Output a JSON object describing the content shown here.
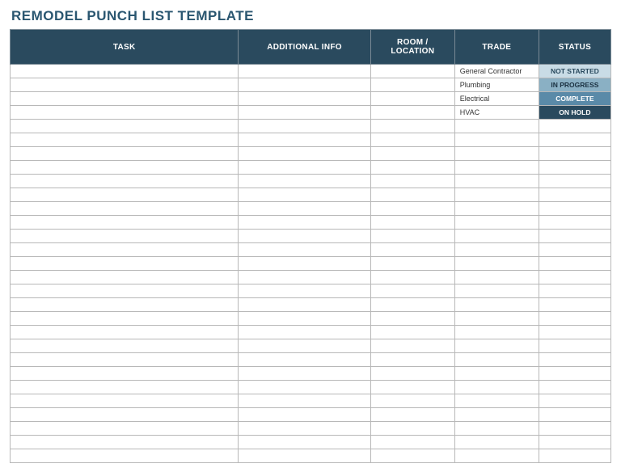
{
  "title": "REMODEL PUNCH LIST TEMPLATE",
  "columns": {
    "task": "TASK",
    "additional_info": "ADDITIONAL INFO",
    "room_location": "ROOM / LOCATION",
    "trade": "TRADE",
    "status": "STATUS"
  },
  "rows": [
    {
      "task": "",
      "info": "",
      "room": "",
      "trade": "General Contractor",
      "status": "NOT STARTED",
      "status_class": "status-not-started"
    },
    {
      "task": "",
      "info": "",
      "room": "",
      "trade": "Plumbing",
      "status": "IN PROGRESS",
      "status_class": "status-in-progress"
    },
    {
      "task": "",
      "info": "",
      "room": "",
      "trade": "Electrical",
      "status": "COMPLETE",
      "status_class": "status-complete"
    },
    {
      "task": "",
      "info": "",
      "room": "",
      "trade": "HVAC",
      "status": "ON HOLD",
      "status_class": "status-on-hold"
    },
    {
      "task": "",
      "info": "",
      "room": "",
      "trade": "",
      "status": "",
      "status_class": ""
    },
    {
      "task": "",
      "info": "",
      "room": "",
      "trade": "",
      "status": "",
      "status_class": ""
    },
    {
      "task": "",
      "info": "",
      "room": "",
      "trade": "",
      "status": "",
      "status_class": ""
    },
    {
      "task": "",
      "info": "",
      "room": "",
      "trade": "",
      "status": "",
      "status_class": ""
    },
    {
      "task": "",
      "info": "",
      "room": "",
      "trade": "",
      "status": "",
      "status_class": ""
    },
    {
      "task": "",
      "info": "",
      "room": "",
      "trade": "",
      "status": "",
      "status_class": ""
    },
    {
      "task": "",
      "info": "",
      "room": "",
      "trade": "",
      "status": "",
      "status_class": ""
    },
    {
      "task": "",
      "info": "",
      "room": "",
      "trade": "",
      "status": "",
      "status_class": ""
    },
    {
      "task": "",
      "info": "",
      "room": "",
      "trade": "",
      "status": "",
      "status_class": ""
    },
    {
      "task": "",
      "info": "",
      "room": "",
      "trade": "",
      "status": "",
      "status_class": ""
    },
    {
      "task": "",
      "info": "",
      "room": "",
      "trade": "",
      "status": "",
      "status_class": ""
    },
    {
      "task": "",
      "info": "",
      "room": "",
      "trade": "",
      "status": "",
      "status_class": ""
    },
    {
      "task": "",
      "info": "",
      "room": "",
      "trade": "",
      "status": "",
      "status_class": ""
    },
    {
      "task": "",
      "info": "",
      "room": "",
      "trade": "",
      "status": "",
      "status_class": ""
    },
    {
      "task": "",
      "info": "",
      "room": "",
      "trade": "",
      "status": "",
      "status_class": ""
    },
    {
      "task": "",
      "info": "",
      "room": "",
      "trade": "",
      "status": "",
      "status_class": ""
    },
    {
      "task": "",
      "info": "",
      "room": "",
      "trade": "",
      "status": "",
      "status_class": ""
    },
    {
      "task": "",
      "info": "",
      "room": "",
      "trade": "",
      "status": "",
      "status_class": ""
    },
    {
      "task": "",
      "info": "",
      "room": "",
      "trade": "",
      "status": "",
      "status_class": ""
    },
    {
      "task": "",
      "info": "",
      "room": "",
      "trade": "",
      "status": "",
      "status_class": ""
    },
    {
      "task": "",
      "info": "",
      "room": "",
      "trade": "",
      "status": "",
      "status_class": ""
    },
    {
      "task": "",
      "info": "",
      "room": "",
      "trade": "",
      "status": "",
      "status_class": ""
    },
    {
      "task": "",
      "info": "",
      "room": "",
      "trade": "",
      "status": "",
      "status_class": ""
    },
    {
      "task": "",
      "info": "",
      "room": "",
      "trade": "",
      "status": "",
      "status_class": ""
    },
    {
      "task": "",
      "info": "",
      "room": "",
      "trade": "",
      "status": "",
      "status_class": ""
    }
  ]
}
